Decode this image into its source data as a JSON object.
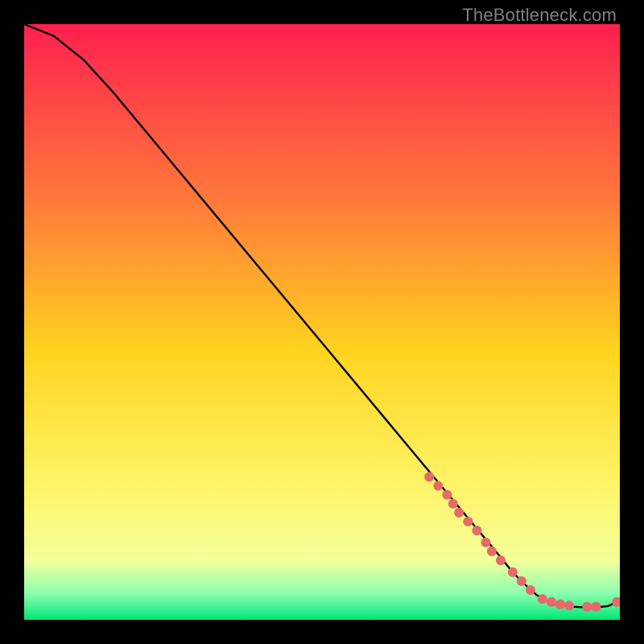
{
  "credit": "TheBottleneck.com",
  "colors": {
    "gradient_top": "#ff2050",
    "gradient_upper_mid": "#ff7a3a",
    "gradient_mid": "#ffd41f",
    "gradient_lower_mid": "#fff56a",
    "gradient_low": "#f4ff9a",
    "gradient_green_top": "#8dffb0",
    "gradient_green": "#00e676",
    "line": "#000000",
    "marker": "#e66a6a",
    "frame": "#000000"
  },
  "chart_data": {
    "type": "line",
    "title": "",
    "xlabel": "",
    "ylabel": "",
    "xlim": [
      0,
      100
    ],
    "ylim": [
      0,
      100
    ],
    "series": [
      {
        "name": "bottleneck-curve",
        "x": [
          0,
          5,
          10,
          15,
          20,
          25,
          30,
          35,
          40,
          45,
          50,
          55,
          60,
          65,
          70,
          75,
          80,
          82,
          84,
          86,
          88,
          90,
          92,
          94,
          96,
          98,
          100
        ],
        "y": [
          100,
          98,
          94,
          88.5,
          82.5,
          76.5,
          70.5,
          64.5,
          58.5,
          52.5,
          46.5,
          40.5,
          34.5,
          28.5,
          22.5,
          16.5,
          10.5,
          8,
          6,
          4.2,
          3,
          2.4,
          2.2,
          2.1,
          2.1,
          2.3,
          3.2
        ]
      }
    ],
    "markers": {
      "name": "highlighted-points",
      "x": [
        68,
        69.5,
        71,
        72,
        73,
        74.5,
        76,
        77.5,
        78.5,
        80,
        82,
        83.5,
        85,
        87,
        88.5,
        90,
        91.5,
        94.5,
        96,
        99.5
      ],
      "y": [
        24,
        22.5,
        21,
        19.5,
        18,
        16.5,
        15,
        13,
        11.5,
        10,
        8,
        6.5,
        5,
        3.5,
        3,
        2.6,
        2.4,
        2.2,
        2.2,
        3.0
      ]
    }
  }
}
